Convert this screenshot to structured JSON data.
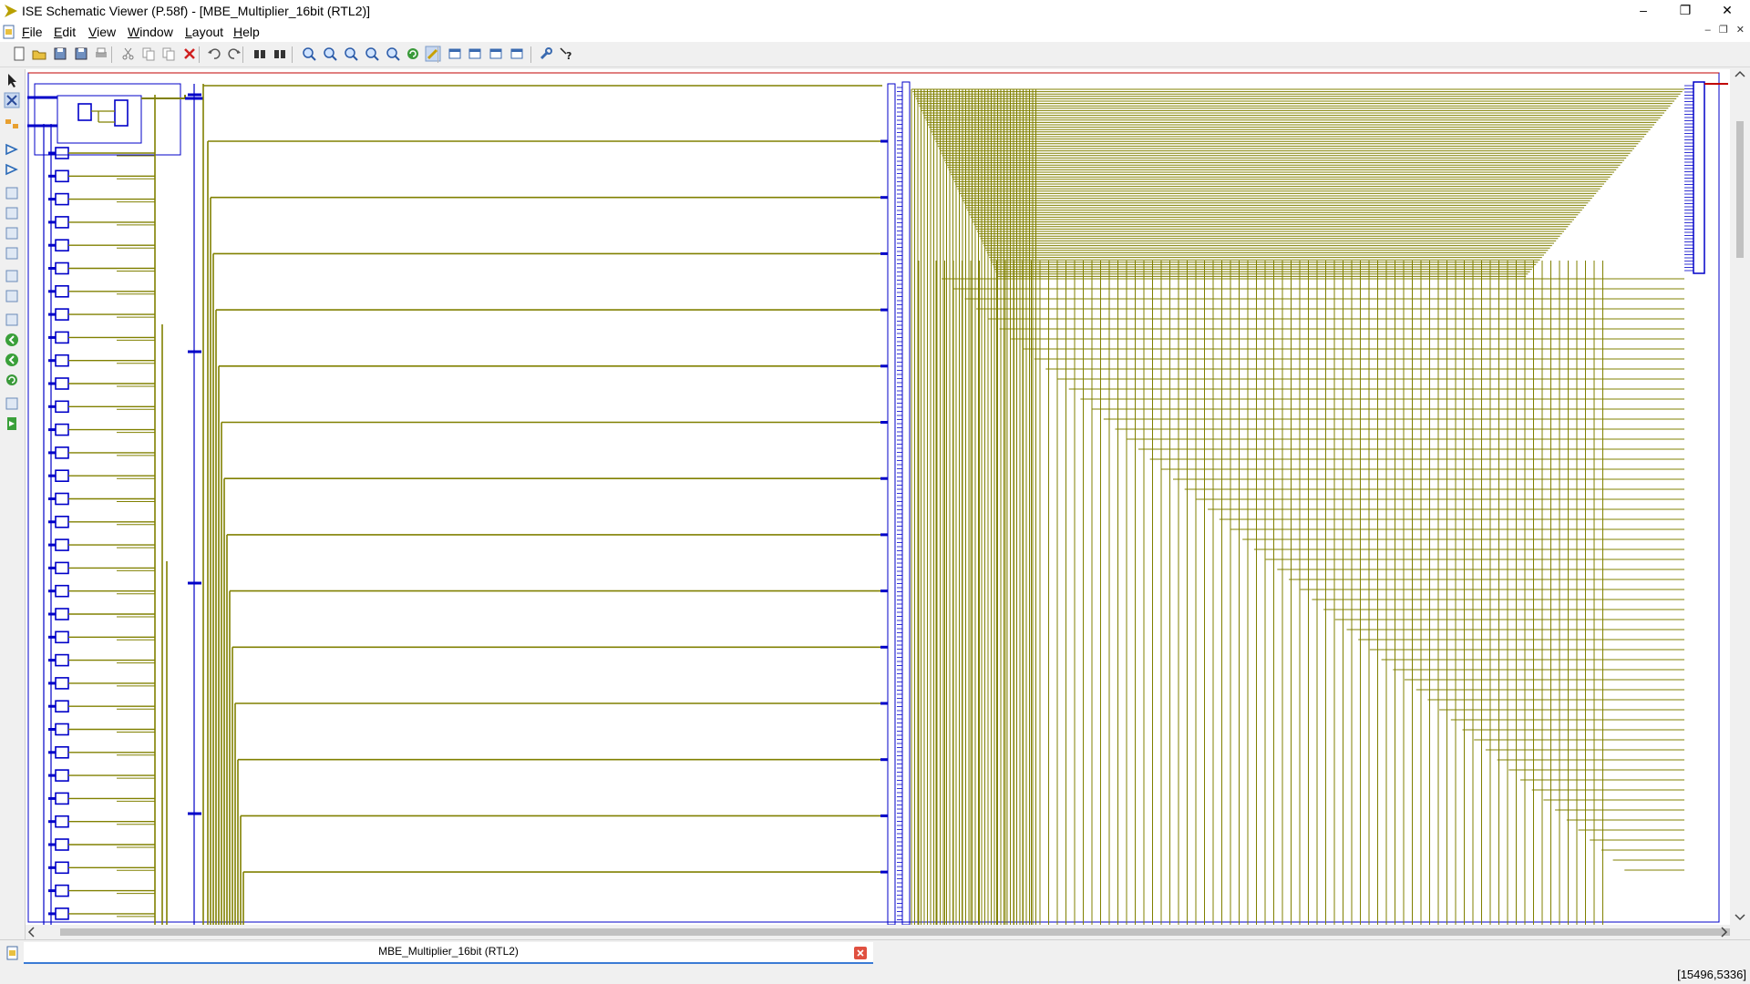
{
  "window": {
    "title": "ISE Schematic Viewer (P.58f) - [MBE_Multiplier_16bit (RTL2)]",
    "icon": "ise-logo-icon"
  },
  "menu": {
    "items": [
      {
        "label": "File",
        "underline": "F"
      },
      {
        "label": "Edit",
        "underline": "E"
      },
      {
        "label": "View",
        "underline": "V"
      },
      {
        "label": "Window",
        "underline": "W"
      },
      {
        "label": "Layout",
        "underline": "L"
      },
      {
        "label": "Help",
        "underline": "H"
      }
    ]
  },
  "toolbar": {
    "icons": [
      "new-icon",
      "open-icon",
      "save-icon",
      "save-all-icon",
      "print-icon",
      "cut-icon",
      "copy-icon",
      "paste-icon",
      "delete-icon",
      "undo-icon",
      "redo-icon",
      "find-icon",
      "find-next-icon",
      "zoom-in-icon",
      "zoom-out-icon",
      "zoom-full-icon",
      "zoom-fit-icon",
      "zoom-selection-icon",
      "refresh-icon",
      "highlight-icon",
      "cascade-icon",
      "tile-horizontal-icon",
      "tile-vertical-icon",
      "arrange-icon",
      "options-icon",
      "context-help-icon"
    ]
  },
  "left_toolbar": {
    "icons": [
      "select-icon",
      "add-wire-icon",
      "hierarchy-icon",
      "push-into-icon",
      "pop-out-icon",
      "show-instance-icon",
      "show-net-icon",
      "properties-icon",
      "properties-2-icon",
      "report-icon",
      "text-icon",
      "move-up-icon",
      "back-icon",
      "forward-icon",
      "refresh-view-icon",
      "expand-icon",
      "go-icon"
    ]
  },
  "colors": {
    "wire": "#808000",
    "symbol": "#0000c8",
    "pin": "#1a3cc8",
    "border": "#c00000"
  },
  "doc_tab": {
    "label": "MBE_Multiplier_16bit (RTL2)"
  },
  "status": {
    "coords": "[15496,5336]"
  }
}
